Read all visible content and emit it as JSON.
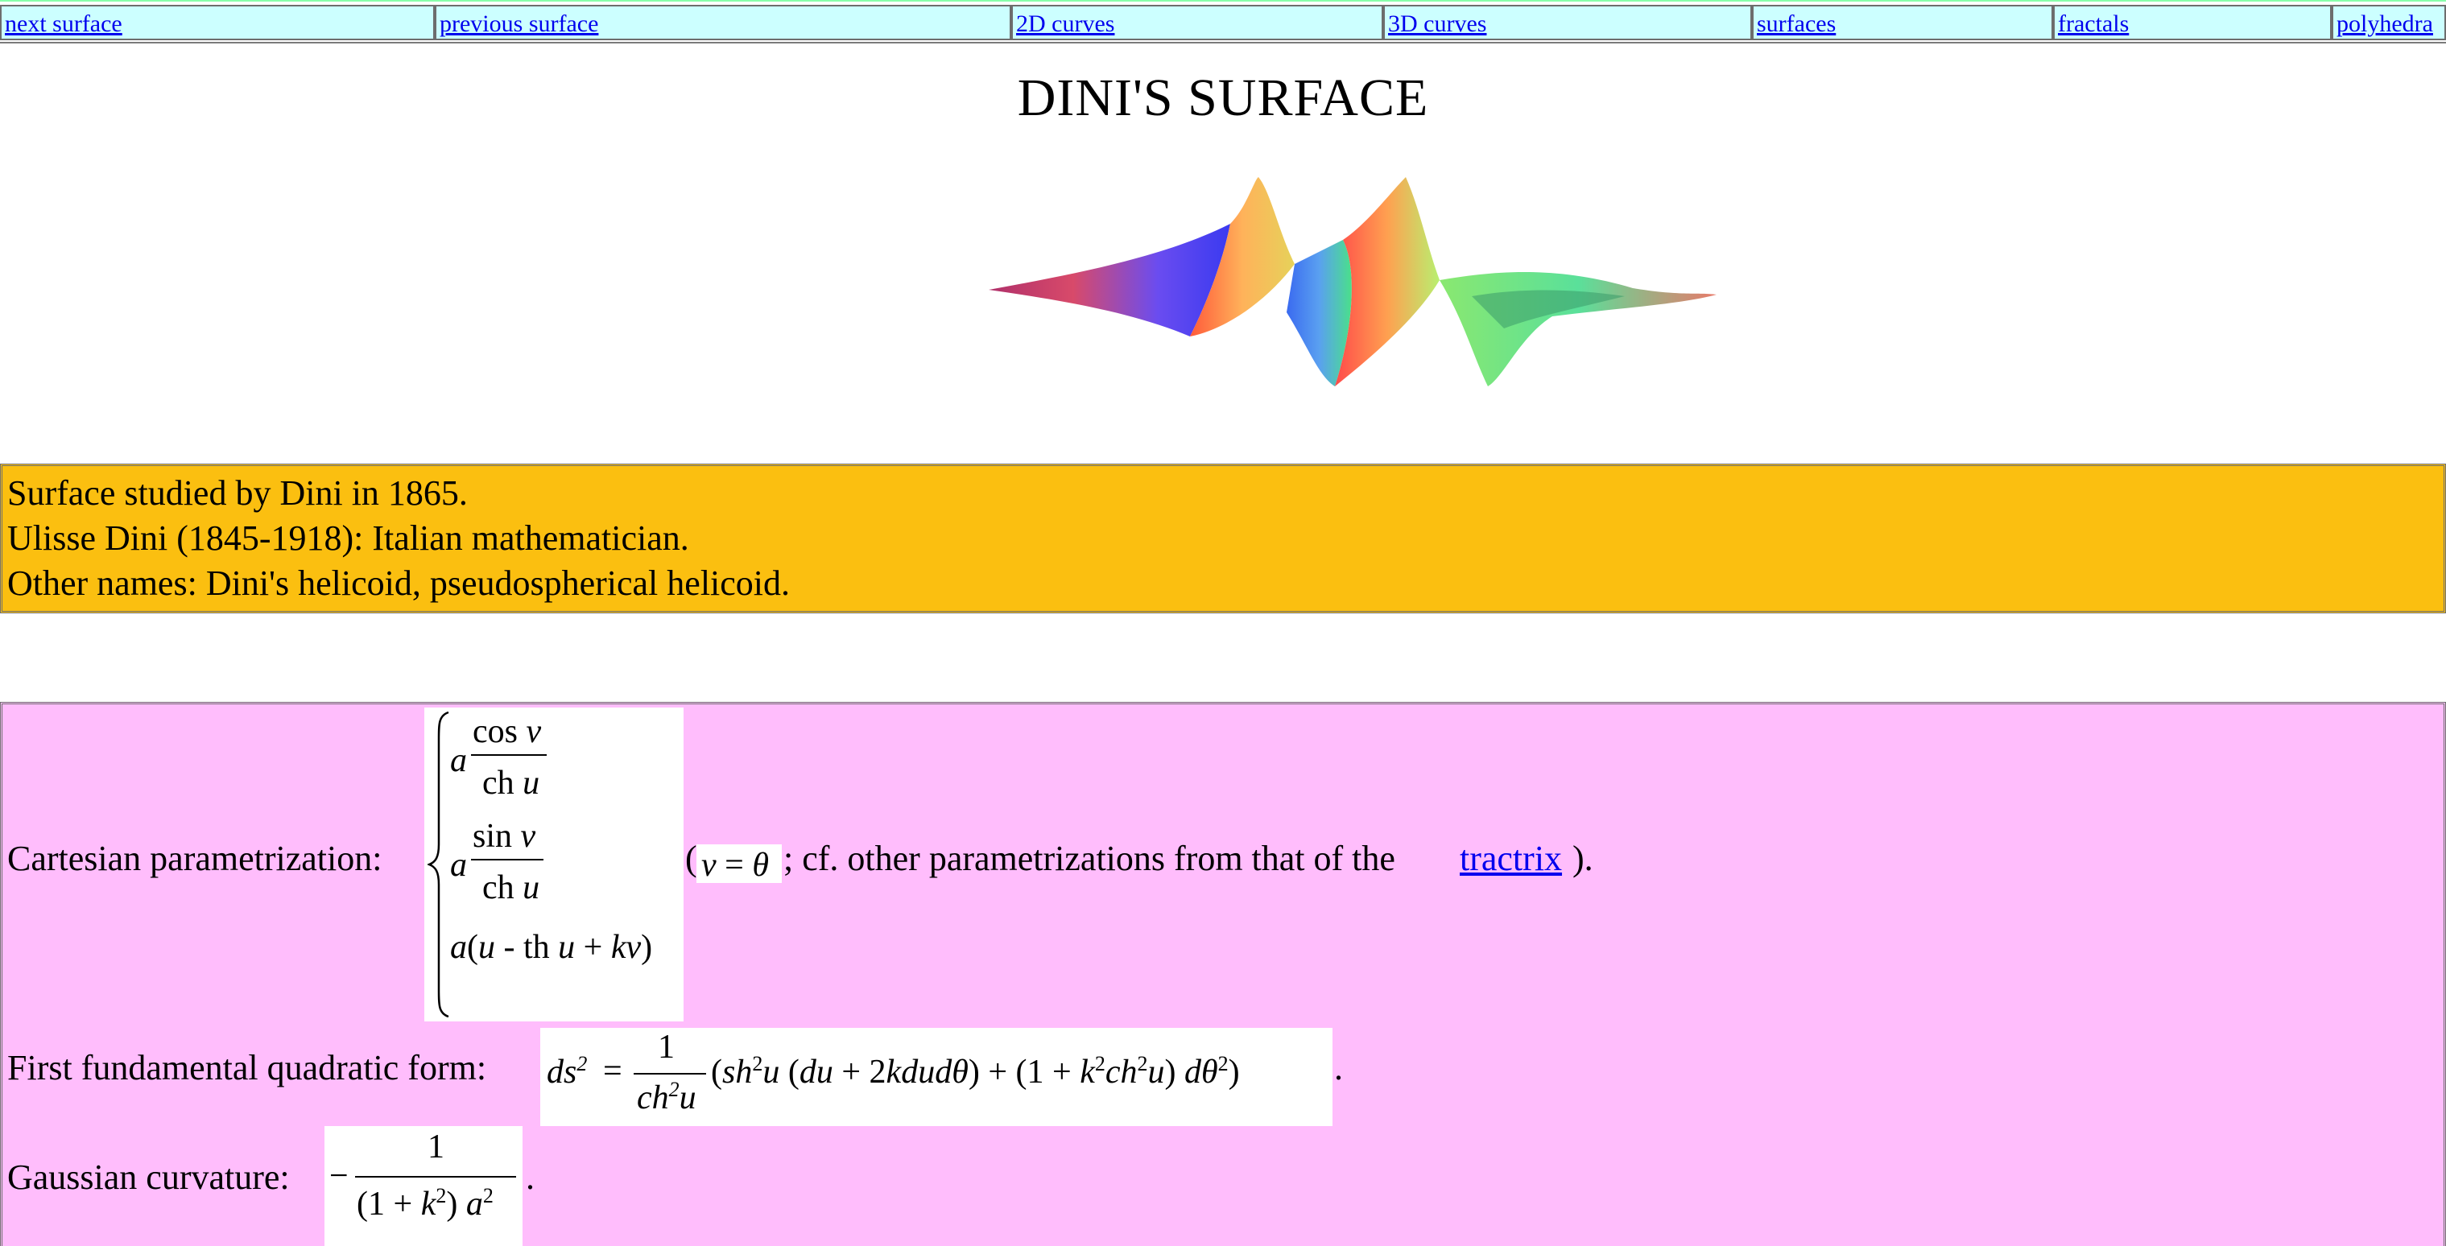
{
  "nav": [
    {
      "label": "next surface"
    },
    {
      "label": "previous surface"
    },
    {
      "label": "2D curves"
    },
    {
      "label": "3D curves"
    },
    {
      "label": "surfaces"
    },
    {
      "label": "fractals"
    },
    {
      "label": "polyhedra"
    }
  ],
  "title": "DINI'S SURFACE",
  "info": {
    "line1": "Surface studied by Dini in 1865.",
    "line2": "Ulisse Dini (1845-1918): Italian mathematician.",
    "line3": "Other names: Dini's helicoid, pseudospherical helicoid."
  },
  "math": {
    "param_label": "Cartesian parametrization:",
    "param_after_open": "(",
    "param_note": "; cf. other parametrizations from that of the ",
    "tractrix_link": "tractrix",
    "param_close": ").",
    "fff_label": "First fundamental quadratic form:",
    "fff_end": ".",
    "gauss_label": "Gaussian curvature:",
    "gauss_end": "."
  },
  "colors": {
    "nav_bg": "#ccffff",
    "info_bg": "#fbbf10",
    "math_bg": "#ffbdfc",
    "link": "#0000ee"
  }
}
